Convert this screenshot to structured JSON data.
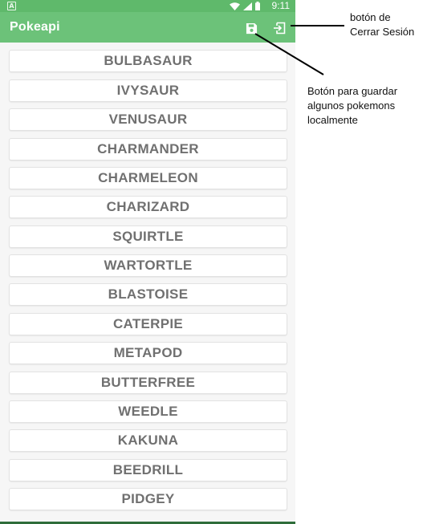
{
  "status_bar": {
    "left_glyph": "A",
    "time": "9:11",
    "icons": [
      "wifi-icon",
      "signal-icon",
      "battery-icon"
    ]
  },
  "app_bar": {
    "title": "Pokeapi",
    "actions": [
      "save-icon",
      "logout-icon"
    ]
  },
  "pokemon_list": [
    {
      "name": "BULBASAUR"
    },
    {
      "name": "IVYSAUR"
    },
    {
      "name": "VENUSAUR"
    },
    {
      "name": "CHARMANDER"
    },
    {
      "name": "CHARMELEON"
    },
    {
      "name": "CHARIZARD"
    },
    {
      "name": "SQUIRTLE"
    },
    {
      "name": "WARTORTLE"
    },
    {
      "name": "BLASTOISE"
    },
    {
      "name": "CATERPIE"
    },
    {
      "name": "METAPOD"
    },
    {
      "name": "BUTTERFREE"
    },
    {
      "name": "WEEDLE"
    },
    {
      "name": "KAKUNA"
    },
    {
      "name": "BEEDRILL"
    },
    {
      "name": "PIDGEY"
    }
  ],
  "annotations": {
    "logout_note": [
      "botón de",
      "Cerrar Sesión"
    ],
    "save_note": [
      "Botón para guardar",
      "algunos pokemons",
      "localmente"
    ]
  },
  "colors": {
    "status_bar": "#5fb96b",
    "app_bar": "#6cc279",
    "item_text": "#707070",
    "list_background": "#f6f6f6"
  }
}
